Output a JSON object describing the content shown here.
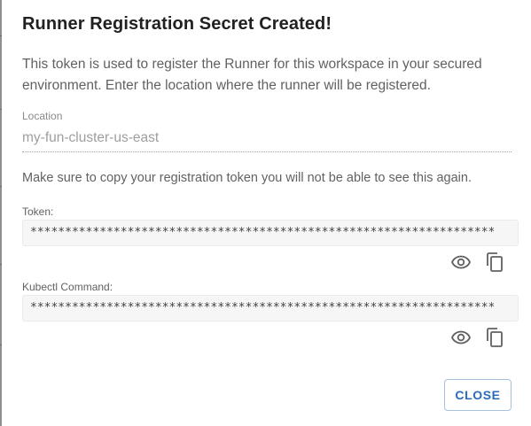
{
  "dialog": {
    "title": "Runner Registration Secret Created!",
    "description": "This token is used to register the Runner for this workspace in your secured environment. Enter the location where the runner will be registered.",
    "location_label": "Location",
    "location_value": "my-fun-cluster-us-east",
    "copy_note": "Make sure to copy your registration token you will not be able to see this again.",
    "token": {
      "label": "Token:",
      "masked_value": "*******************************************************************"
    },
    "kubectl": {
      "label": "Kubectl Command:",
      "masked_value": "*******************************************************************"
    },
    "close_label": "CLOSE"
  },
  "icons": {
    "reveal": "eye-icon",
    "copy": "copy-icon"
  },
  "colors": {
    "title": "#212121",
    "body_text": "#616161",
    "accent": "#2a6cb8",
    "secret_bg": "#f6f6f6"
  }
}
